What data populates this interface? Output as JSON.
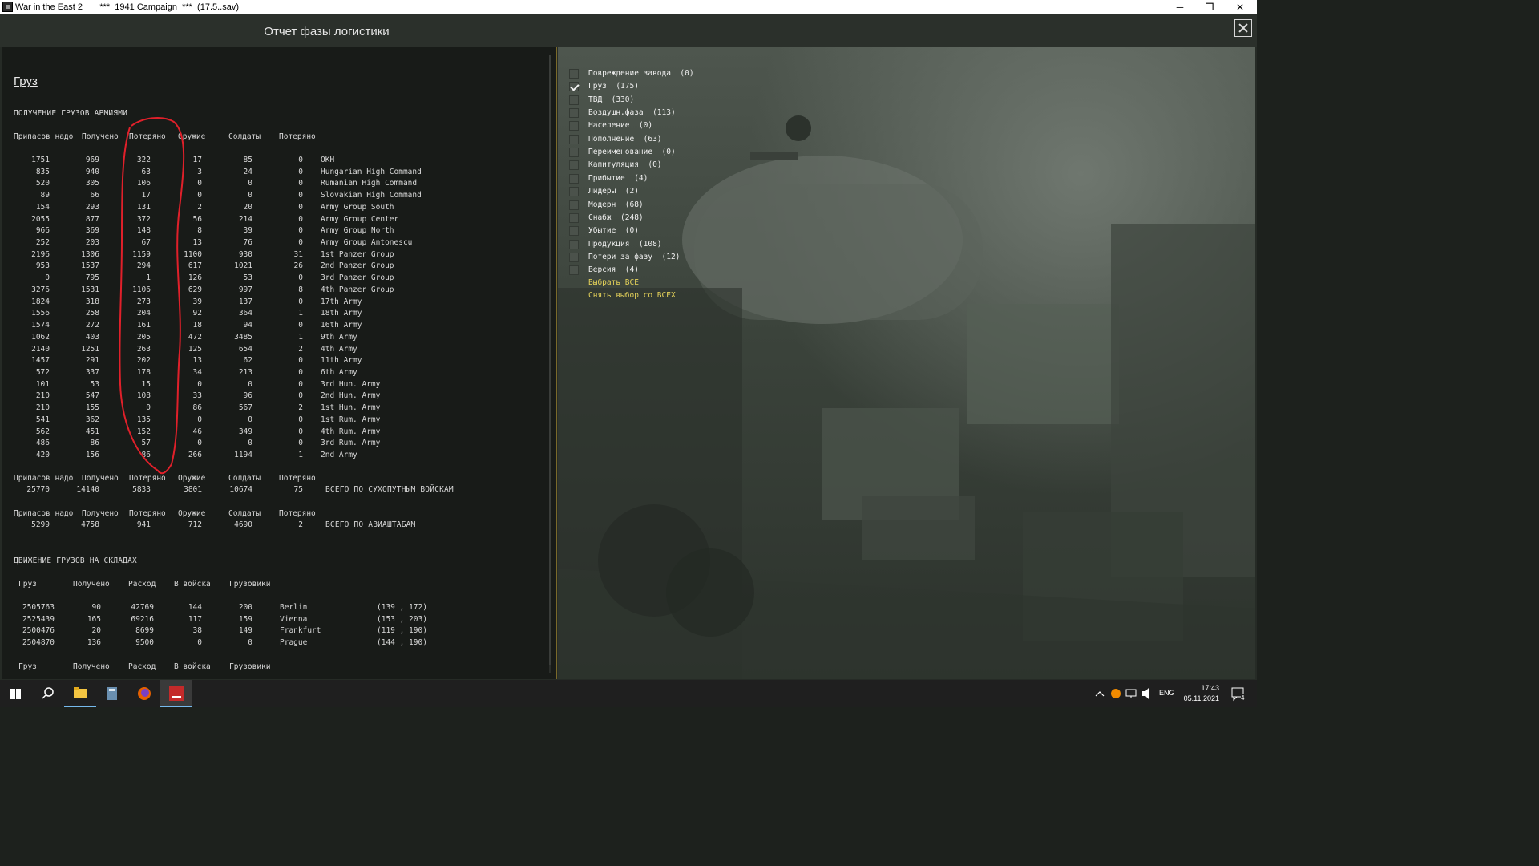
{
  "window": {
    "title": "War in the East 2       ***  1941 Campaign  ***  (17.5..sav)",
    "min_glyph": "─",
    "max_glyph": "❐",
    "close_glyph": "✕"
  },
  "header": {
    "title": "Отчет фазы логистики"
  },
  "report": {
    "section_title": "Груз",
    "army_receipts": {
      "heading": "ПОЛУЧЕНИЕ ГРУЗОВ АРМИЯМИ",
      "columns": [
        "Припасов надо",
        "Получено",
        "Потеряно",
        "Оружие",
        "Солдаты",
        "Потеряно"
      ],
      "rows": [
        [
          "1751",
          "969",
          "322",
          "17",
          "85",
          "0",
          "OKH"
        ],
        [
          "835",
          "940",
          "63",
          "3",
          "24",
          "0",
          "Hungarian High Command"
        ],
        [
          "520",
          "305",
          "106",
          "0",
          "0",
          "0",
          "Rumanian High Command"
        ],
        [
          "89",
          "66",
          "17",
          "0",
          "0",
          "0",
          "Slovakian High Command"
        ],
        [
          "154",
          "293",
          "131",
          "2",
          "20",
          "0",
          "Army Group South"
        ],
        [
          "2055",
          "877",
          "372",
          "56",
          "214",
          "0",
          "Army Group Center"
        ],
        [
          "966",
          "369",
          "148",
          "8",
          "39",
          "0",
          "Army Group North"
        ],
        [
          "252",
          "203",
          "67",
          "13",
          "76",
          "0",
          "Army Group Antonescu"
        ],
        [
          "2196",
          "1306",
          "1159",
          "1100",
          "930",
          "31",
          "1st Panzer Group"
        ],
        [
          "953",
          "1537",
          "294",
          "617",
          "1021",
          "26",
          "2nd Panzer Group"
        ],
        [
          "0",
          "795",
          "1",
          "126",
          "53",
          "0",
          "3rd Panzer Group"
        ],
        [
          "3276",
          "1531",
          "1106",
          "629",
          "997",
          "8",
          "4th Panzer Group"
        ],
        [
          "1824",
          "318",
          "273",
          "39",
          "137",
          "0",
          "17th Army"
        ],
        [
          "1556",
          "258",
          "204",
          "92",
          "364",
          "1",
          "18th Army"
        ],
        [
          "1574",
          "272",
          "161",
          "18",
          "94",
          "0",
          "16th Army"
        ],
        [
          "1062",
          "403",
          "205",
          "472",
          "3485",
          "1",
          "9th Army"
        ],
        [
          "2140",
          "1251",
          "263",
          "125",
          "654",
          "2",
          "4th Army"
        ],
        [
          "1457",
          "291",
          "202",
          "13",
          "62",
          "0",
          "11th Army"
        ],
        [
          "572",
          "337",
          "178",
          "34",
          "213",
          "0",
          "6th Army"
        ],
        [
          "101",
          "53",
          "15",
          "0",
          "0",
          "0",
          "3rd Hun. Army"
        ],
        [
          "210",
          "547",
          "108",
          "33",
          "96",
          "0",
          "2nd Hun. Army"
        ],
        [
          "210",
          "155",
          "0",
          "86",
          "567",
          "2",
          "1st Hun. Army"
        ],
        [
          "541",
          "362",
          "135",
          "0",
          "0",
          "0",
          "1st Rum. Army"
        ],
        [
          "562",
          "451",
          "152",
          "46",
          "349",
          "0",
          "4th Rum. Army"
        ],
        [
          "486",
          "86",
          "57",
          "0",
          "0",
          "0",
          "3rd Rum. Army"
        ],
        [
          "420",
          "156",
          "86",
          "266",
          "1194",
          "1",
          "2nd Army"
        ]
      ],
      "ground_total": {
        "columns": [
          "Припасов надо",
          "Получено",
          "Потеряно",
          "Оружие",
          "Солдаты",
          "Потеряно"
        ],
        "values": [
          "25770",
          "14140",
          "5833",
          "3801",
          "10674",
          "75"
        ],
        "label": "ВСЕГО ПО СУХОПУТНЫМ ВОЙСКАМ"
      },
      "air_total": {
        "columns": [
          "Припасов надо",
          "Получено",
          "Потеряно",
          "Оружие",
          "Солдаты",
          "Потеряно"
        ],
        "values": [
          "5299",
          "4758",
          "941",
          "712",
          "4690",
          "2"
        ],
        "label": "ВСЕГО ПО АВИАШТАБАМ"
      }
    },
    "depot_movement": {
      "heading": "ДВИЖЕНИЕ ГРУЗОВ НА СКЛАДАХ",
      "columns": [
        "Груз",
        "Получено",
        "Расход",
        "В войска",
        "Грузовики"
      ],
      "rows": [
        [
          "2505763",
          "90",
          "42769",
          "144",
          "200",
          "Berlin",
          "(139 , 172)"
        ],
        [
          "2525439",
          "165",
          "69216",
          "117",
          "159",
          "Vienna",
          "(153 , 203)"
        ],
        [
          "2500476",
          "20",
          "8699",
          "38",
          "149",
          "Frankfurt",
          "(119 , 190)"
        ],
        [
          "2504870",
          "136",
          "9500",
          "0",
          "0",
          "Prague",
          "(144 , 190)"
        ]
      ],
      "next_columns": [
        "Груз",
        "Получено",
        "Расход",
        "В войска",
        "Грузовики"
      ]
    }
  },
  "filters": {
    "items": [
      {
        "label": "Повреждение завода  (0)",
        "checked": false
      },
      {
        "label": "Груз  (175)",
        "checked": true
      },
      {
        "label": "ТВД  (330)",
        "checked": false
      },
      {
        "label": "Воздушн.фаза  (113)",
        "checked": false
      },
      {
        "label": "Население  (0)",
        "checked": false
      },
      {
        "label": "Пополнение  (63)",
        "checked": false
      },
      {
        "label": "Переименование  (0)",
        "checked": false
      },
      {
        "label": "Капитуляция  (0)",
        "checked": false
      },
      {
        "label": "Прибытие  (4)",
        "checked": false
      },
      {
        "label": "Лидеры  (2)",
        "checked": false
      },
      {
        "label": "Модерн  (68)",
        "checked": false
      },
      {
        "label": "Снабж  (248)",
        "checked": false
      },
      {
        "label": "Убытие  (0)",
        "checked": false
      },
      {
        "label": "Продукция  (108)",
        "checked": false
      },
      {
        "label": "Потери за фазу  (12)",
        "checked": false
      },
      {
        "label": "Версия  (4)",
        "checked": false
      }
    ],
    "select_all": "Выбрать ВСЕ",
    "deselect_all": "Снять выбор со ВСЕХ"
  },
  "annotation_color": "#e0202a",
  "taskbar": {
    "icons": [
      "windows-start-icon",
      "search-icon",
      "file-explorer-icon",
      "calculator-icon",
      "firefox-icon",
      "wite-game-icon"
    ],
    "lang": "ENG",
    "time": "17:43",
    "date": "05.11.2021",
    "notification_count": "4"
  }
}
